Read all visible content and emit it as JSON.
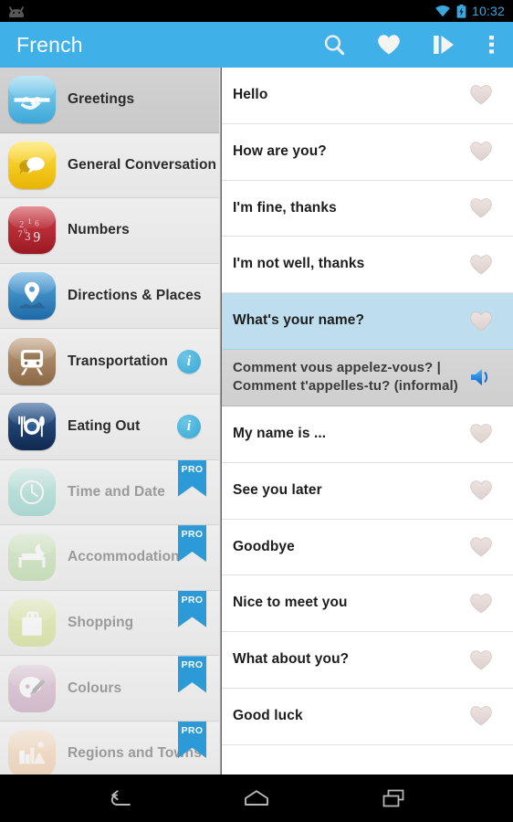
{
  "status_bar": {
    "time": "10:32",
    "icons": [
      "android-robot-icon",
      "wifi-icon",
      "battery-charging-icon"
    ]
  },
  "action_bar": {
    "title": "French",
    "actions": [
      {
        "name": "search-icon",
        "label": "Search"
      },
      {
        "name": "favourites-heart-icon",
        "label": "Favourites"
      },
      {
        "name": "flashcards-play-icon",
        "label": "Flashcards"
      },
      {
        "name": "overflow-menu-icon",
        "label": "More options"
      }
    ]
  },
  "sidebar": {
    "items": [
      {
        "label": "Greetings",
        "icon": "handshake-icon",
        "selected": true,
        "locked": false,
        "badge": null,
        "bg1": "#8fd5ef",
        "bg2": "#3ba7d8",
        "glyph": "✋"
      },
      {
        "label": "General Conversation",
        "icon": "speech-bubbles-icon",
        "selected": false,
        "locked": false,
        "badge": null,
        "bg1": "#ffe04a",
        "bg2": "#e8b400",
        "glyph": "💬"
      },
      {
        "label": "Numbers",
        "icon": "numbers-icon",
        "selected": false,
        "locked": false,
        "badge": null,
        "bg1": "#d0404a",
        "bg2": "#9b1922",
        "glyph": "123"
      },
      {
        "label": "Directions & Places",
        "icon": "map-pin-icon",
        "selected": false,
        "locked": false,
        "badge": null,
        "bg1": "#5aa8dc",
        "bg2": "#1d6aa8",
        "glyph": "📍"
      },
      {
        "label": "Transportation",
        "icon": "train-icon",
        "selected": false,
        "locked": false,
        "badge": "info",
        "bg1": "#c0a080",
        "bg2": "#8c6844",
        "glyph": "🚆"
      },
      {
        "label": "Eating Out",
        "icon": "cutlery-plate-icon",
        "selected": false,
        "locked": false,
        "badge": "info",
        "bg1": "#2e5c96",
        "bg2": "#10294f",
        "glyph": "🍽"
      },
      {
        "label": "Time and Date",
        "icon": "clock-icon",
        "selected": false,
        "locked": true,
        "badge": "PRO",
        "bg1": "#9adbd0",
        "bg2": "#61c3b4",
        "glyph": "🕓"
      },
      {
        "label": "Accommodation",
        "icon": "bed-moon-icon",
        "selected": false,
        "locked": true,
        "badge": "PRO",
        "bg1": "#bfe0a8",
        "bg2": "#9ccd80",
        "glyph": "🛏"
      },
      {
        "label": "Shopping",
        "icon": "shopping-bag-icon",
        "selected": false,
        "locked": true,
        "badge": "PRO",
        "bg1": "#d7e489",
        "bg2": "#c2d562",
        "glyph": "🛍"
      },
      {
        "label": "Colours",
        "icon": "palette-brush-icon",
        "selected": false,
        "locked": true,
        "badge": "PRO",
        "bg1": "#cda7c0",
        "bg2": "#b684a6",
        "glyph": "🎨"
      },
      {
        "label": "Regions and Towns",
        "icon": "cityscape-icon",
        "selected": false,
        "locked": true,
        "badge": "PRO",
        "bg1": "#f6cfa4",
        "bg2": "#eeb887",
        "glyph": "🏙"
      }
    ]
  },
  "phrase_list": {
    "rows": [
      {
        "type": "phrase",
        "text": "Hello",
        "selected": false,
        "action": "heart"
      },
      {
        "type": "phrase",
        "text": "How are you?",
        "selected": false,
        "action": "heart"
      },
      {
        "type": "phrase",
        "text": "I'm fine, thanks",
        "selected": false,
        "action": "heart"
      },
      {
        "type": "phrase",
        "text": "I'm not well, thanks",
        "selected": false,
        "action": "heart"
      },
      {
        "type": "phrase",
        "text": "What's your name?",
        "selected": true,
        "action": "heart"
      },
      {
        "type": "translation",
        "text": "Comment vous appelez-vous? | Comment t'appelles-tu? (informal)",
        "selected": false,
        "action": "speaker"
      },
      {
        "type": "phrase",
        "text": "My name is ...",
        "selected": false,
        "action": "heart"
      },
      {
        "type": "phrase",
        "text": "See you later",
        "selected": false,
        "action": "heart"
      },
      {
        "type": "phrase",
        "text": "Goodbye",
        "selected": false,
        "action": "heart"
      },
      {
        "type": "phrase",
        "text": "Nice to meet you",
        "selected": false,
        "action": "heart"
      },
      {
        "type": "phrase",
        "text": "What about you?",
        "selected": false,
        "action": "heart"
      },
      {
        "type": "phrase",
        "text": "Good luck",
        "selected": false,
        "action": "heart"
      }
    ]
  },
  "nav_bar": {
    "buttons": [
      {
        "name": "back-icon",
        "label": "Back"
      },
      {
        "name": "home-icon",
        "label": "Home"
      },
      {
        "name": "recents-icon",
        "label": "Recent apps"
      }
    ]
  },
  "colors": {
    "accent": "#40b0e8",
    "selected_row": "#bfdeed",
    "translation_row": "#d2d2d2",
    "pro_badge": "#2d9ad8",
    "status_text": "#3ba7de"
  }
}
